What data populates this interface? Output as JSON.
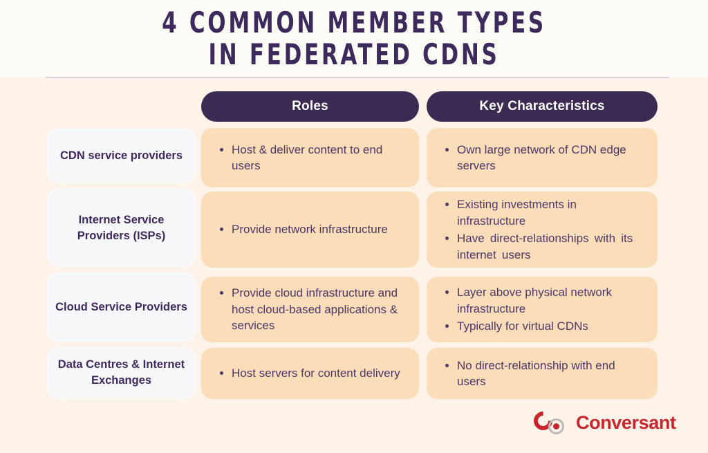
{
  "title": {
    "line1": "4 Common Member Types",
    "line2": "in Federated CDNs"
  },
  "colors": {
    "background_top": "#FDFBF6",
    "background_bottom": "#FDF3E9",
    "header_pill": "#3B2A52",
    "content_card": "#FCDDB9",
    "row_label_card": "#F8F7F9",
    "text_purple": "#3D2A5C",
    "body_text": "#4A3766",
    "logo_red": "#C8262C",
    "divider": "#D8CFDD"
  },
  "table": {
    "columns": [
      {
        "label": "Roles"
      },
      {
        "label": "Key Characteristics"
      }
    ],
    "rows": [
      {
        "label": "CDN service providers",
        "roles": [
          "Host & deliver content to end users"
        ],
        "characteristics": [
          "Own large network of CDN edge servers"
        ]
      },
      {
        "label": "Internet Service Providers (ISPs)",
        "roles": [
          "Provide network infrastructure"
        ],
        "characteristics": [
          "Existing investments in infrastructure",
          "Have direct-relationships with its internet users"
        ]
      },
      {
        "label": "Cloud Service Providers",
        "roles": [
          "Provide cloud infrastructure and host cloud-based applications & services"
        ],
        "characteristics": [
          "Layer above physical network infrastructure",
          "Typically for virtual CDNs"
        ]
      },
      {
        "label": "Data Centres & Internet Exchanges",
        "roles": [
          "Host servers for content delivery"
        ],
        "characteristics": [
          "No direct-relationship with end users"
        ]
      }
    ]
  },
  "logo": {
    "wordmark": "Conversant",
    "mark": "conversant-target-icon"
  }
}
